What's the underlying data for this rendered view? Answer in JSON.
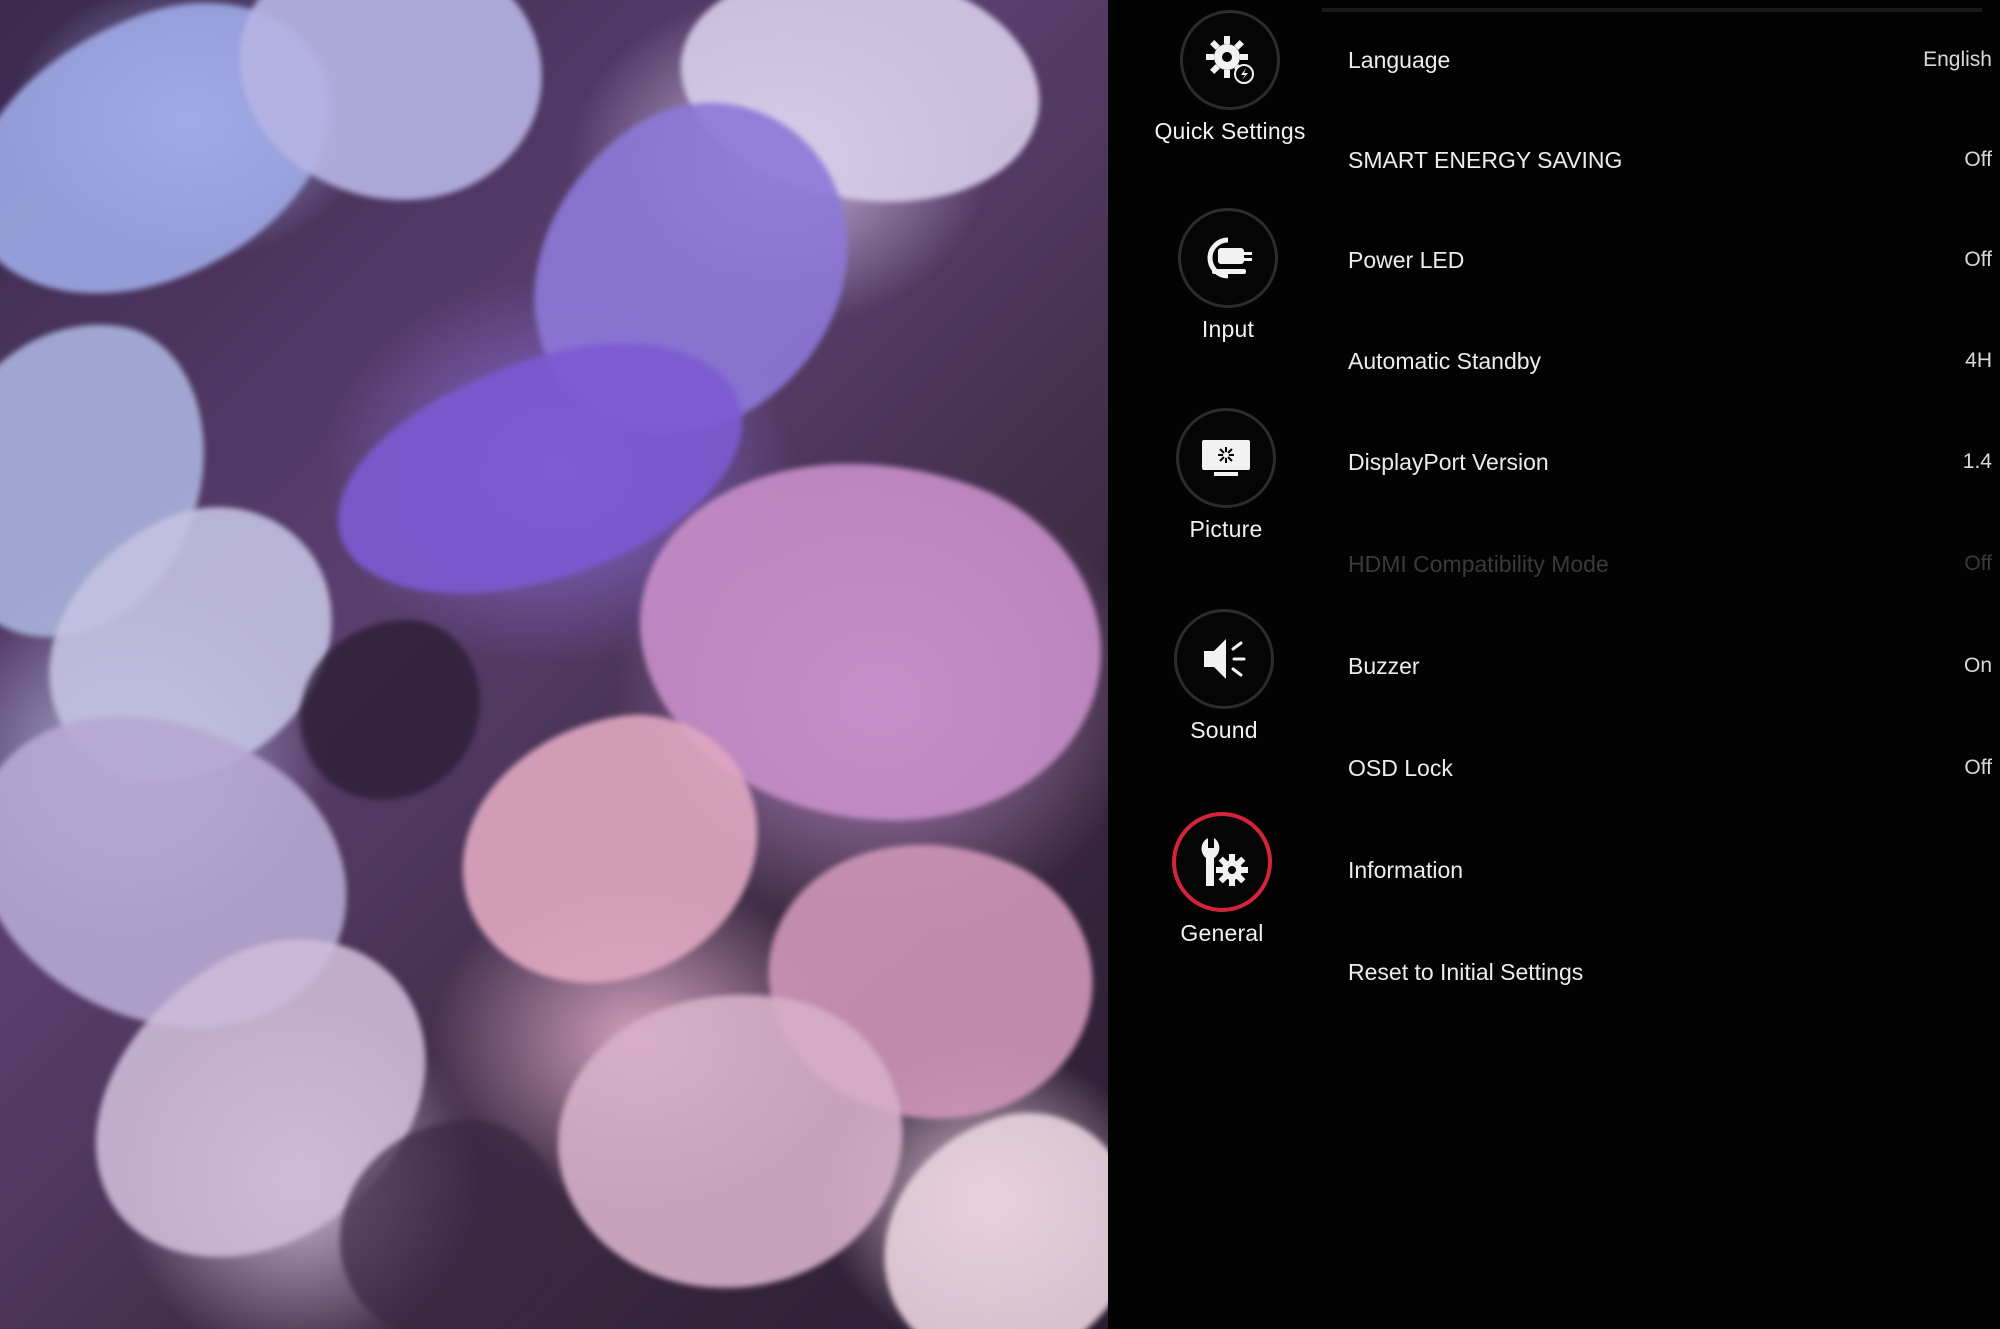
{
  "nav": [
    {
      "id": "quick-settings",
      "label": "Quick Settings",
      "icon": "gear-icon",
      "active": false
    },
    {
      "id": "input",
      "label": "Input",
      "icon": "input-source-icon",
      "active": false
    },
    {
      "id": "picture",
      "label": "Picture",
      "icon": "monitor-icon",
      "active": false
    },
    {
      "id": "sound",
      "label": "Sound",
      "icon": "speaker-icon",
      "active": false
    },
    {
      "id": "general",
      "label": "General",
      "icon": "wrench-gear-icon",
      "active": true
    }
  ],
  "settings": [
    {
      "label": "Language",
      "value": "English",
      "enabled": true
    },
    {
      "label": "SMART ENERGY SAVING",
      "value": "Off",
      "enabled": true
    },
    {
      "label": "Power LED",
      "value": "Off",
      "enabled": true
    },
    {
      "label": "Automatic Standby",
      "value": "4H",
      "enabled": true
    },
    {
      "label": "DisplayPort Version",
      "value": "1.4",
      "enabled": true
    },
    {
      "label": "HDMI Compatibility Mode",
      "value": "Off",
      "enabled": false
    },
    {
      "label": "Buzzer",
      "value": "On",
      "enabled": true
    },
    {
      "label": "OSD Lock",
      "value": "Off",
      "enabled": true
    },
    {
      "label": "Information",
      "value": "",
      "enabled": true
    },
    {
      "label": "Reset to Initial Settings",
      "value": "",
      "enabled": true
    }
  ],
  "colors": {
    "accent": "#d5233a",
    "background": "#030303",
    "text": "#ececec",
    "disabled_text": "#3a3a3a"
  }
}
